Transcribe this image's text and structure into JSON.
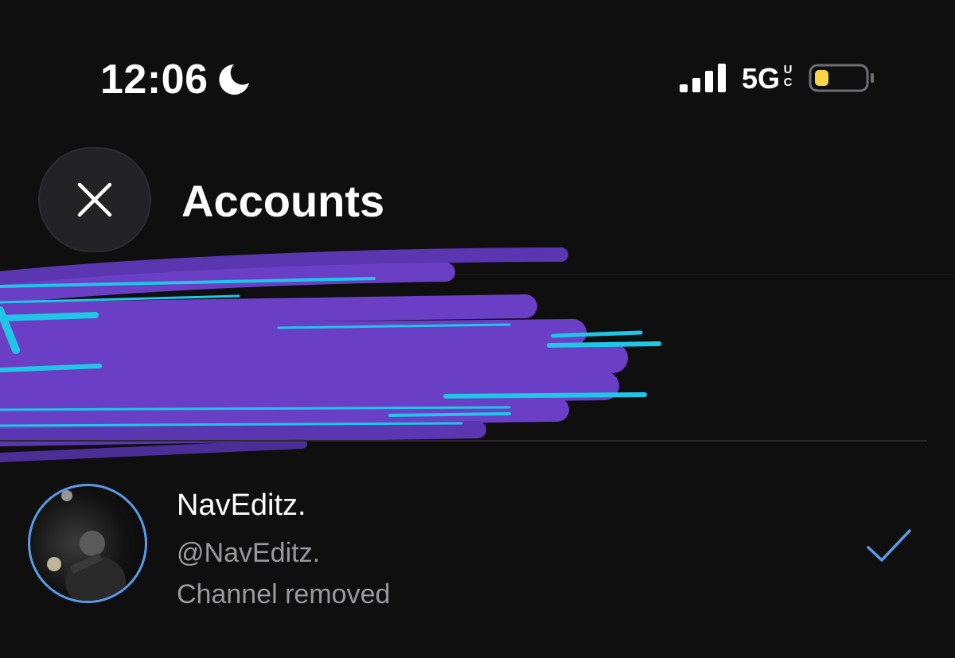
{
  "status_bar": {
    "time": "12:06",
    "network": "5G",
    "network_suffix": "UC",
    "icons": [
      "moon-icon",
      "signal-icon",
      "battery-icon"
    ],
    "battery_level": 0.25,
    "battery_color": "#f5d547"
  },
  "header": {
    "title": "Accounts",
    "close_icon": "close-icon"
  },
  "accounts": [
    {
      "name": "NavEditz.",
      "handle": "@NavEditz.",
      "status": "Channel removed",
      "selected": true
    }
  ],
  "colors": {
    "background": "#0f0f10",
    "accent": "#5b9be8",
    "secondary_text": "#9a9a9e",
    "scribble_purple": "#6a3fc6",
    "scribble_cyan": "#1fc6e6"
  }
}
